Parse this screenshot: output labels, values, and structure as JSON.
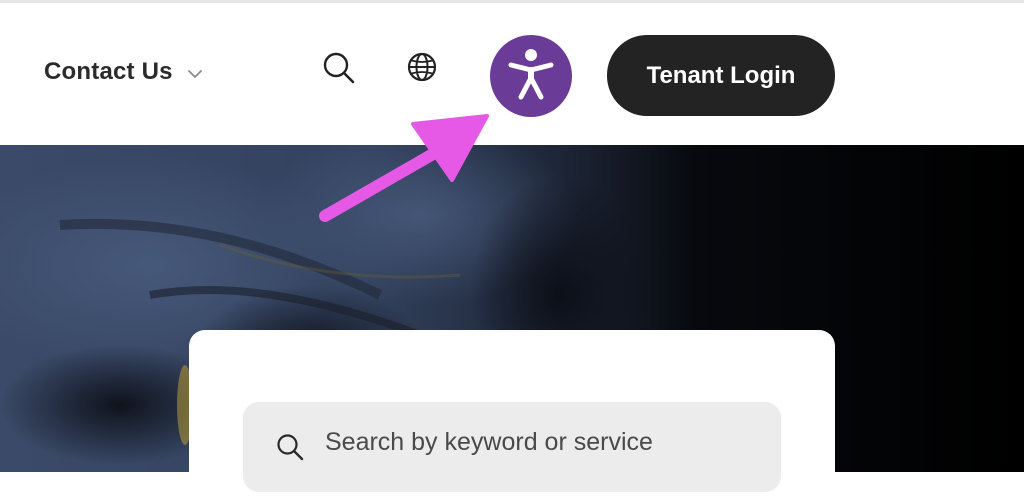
{
  "header": {
    "contact_label": "Contact Us",
    "contact_chevron_icon": "chevron-down-icon",
    "search_icon": "search-icon",
    "language_icon": "globe-icon",
    "accessibility_icon": "accessibility-person-icon",
    "login_label": "Tenant Login"
  },
  "colors": {
    "accessibility_bg": "#6a3c97",
    "login_bg": "#232323",
    "annotation_arrow": "#e659e6"
  },
  "annotation": {
    "type": "arrow",
    "points_to": "accessibility-button"
  },
  "search": {
    "placeholder": "Search by keyword or service",
    "icon": "search-icon"
  }
}
